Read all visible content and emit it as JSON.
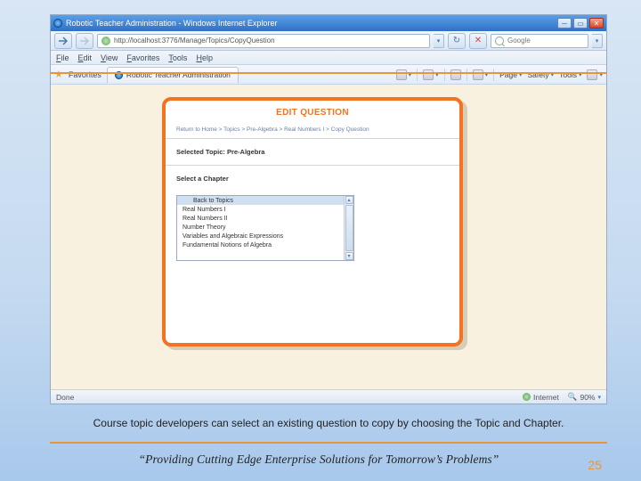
{
  "browser": {
    "title": "Robotic Teacher Administration - Windows Internet Explorer",
    "address": "http://localhost:3776/Manage/Topics/CopyQuestion",
    "search_placeholder": "Google",
    "menus": [
      "File",
      "Edit",
      "View",
      "Favorites",
      "Tools",
      "Help"
    ],
    "favorites_label": "Favorites",
    "tab_label": "Robotic Teacher Administration",
    "toolbar": {
      "page": "Page",
      "safety": "Safety",
      "tools": "Tools"
    },
    "status_left": "Done",
    "status_internet": "Internet",
    "status_zoom": "90%"
  },
  "page": {
    "heading": "EDIT QUESTION",
    "breadcrumbs": "Return to Home > Topics > Pre-Algebra > Real Numbers I > Copy Question",
    "selected_topic_label": "Selected Topic: Pre-Algebra",
    "select_chapter_label": "Select a Chapter",
    "chapters": [
      "Back to Topics",
      "Real Numbers I",
      "Real Numbers II",
      "Number Theory",
      "Variables and Algebraic Expressions",
      "Fundamental Notions of Algebra"
    ]
  },
  "slide": {
    "caption": "Course topic developers can select an existing question to copy by choosing the Topic and Chapter.",
    "tagline": "“Providing Cutting Edge Enterprise Solutions for Tomorrow’s Problems”",
    "page_number": "25"
  }
}
